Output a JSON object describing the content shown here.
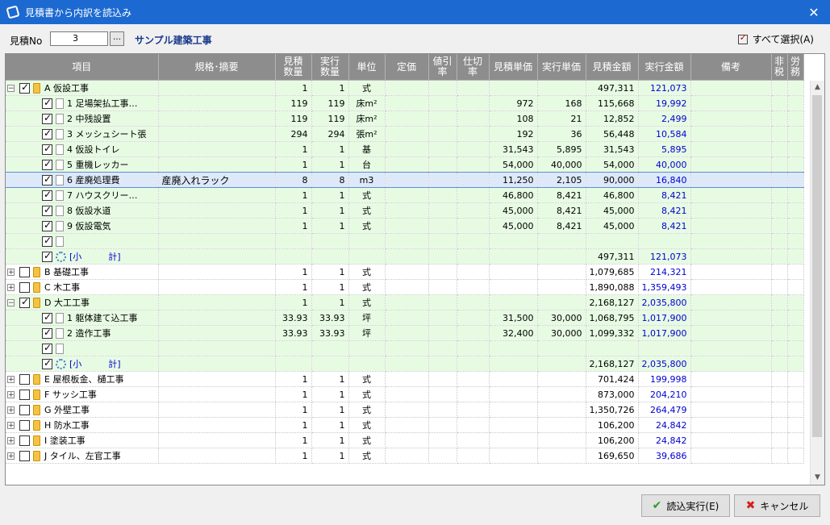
{
  "window": {
    "title": "見積書から内訳を読込み",
    "close": "✕"
  },
  "toolbar": {
    "no_label": "見積No",
    "no_value": "3",
    "browse_label": "…",
    "project_name": "サンプル建築工事",
    "select_all": "すべて選択(A)"
  },
  "columns": [
    "項目",
    "規格･摘要",
    "見積\n数量",
    "実行\n数量",
    "単位",
    "定価",
    "値引\n率",
    "仕切\n率",
    "見積単価",
    "実行単価",
    "見積金額",
    "実行金額",
    "備考",
    "非\n税",
    "労\n務"
  ],
  "rows": [
    {
      "style": "green",
      "expander": "−",
      "checked": true,
      "icon": "folder",
      "label": "A 仮設工事",
      "spec": "",
      "qty": "1",
      "exec_qty": "1",
      "unit": "式",
      "price": "",
      "disc": "",
      "part": "",
      "unit_price": "",
      "exec_unit_price": "",
      "amount": "497,311",
      "exec_amount": "121,073"
    },
    {
      "style": "green",
      "expander": "",
      "checked": true,
      "icon": "doc",
      "label": "1 足場架払工事…",
      "spec": "",
      "qty": "119",
      "exec_qty": "119",
      "unit": "床m²",
      "price": "",
      "disc": "",
      "part": "",
      "unit_price": "972",
      "exec_unit_price": "168",
      "amount": "115,668",
      "exec_amount": "19,992"
    },
    {
      "style": "green",
      "expander": "",
      "checked": true,
      "icon": "doc",
      "label": "2 中残設置",
      "spec": "",
      "qty": "119",
      "exec_qty": "119",
      "unit": "床m²",
      "price": "",
      "disc": "",
      "part": "",
      "unit_price": "108",
      "exec_unit_price": "21",
      "amount": "12,852",
      "exec_amount": "2,499"
    },
    {
      "style": "green",
      "expander": "",
      "checked": true,
      "icon": "doc",
      "label": "3 メッシュシート張",
      "spec": "",
      "qty": "294",
      "exec_qty": "294",
      "unit": "張m²",
      "price": "",
      "disc": "",
      "part": "",
      "unit_price": "192",
      "exec_unit_price": "36",
      "amount": "56,448",
      "exec_amount": "10,584"
    },
    {
      "style": "green",
      "expander": "",
      "checked": true,
      "icon": "doc",
      "label": "4 仮設トイレ",
      "spec": "",
      "qty": "1",
      "exec_qty": "1",
      "unit": "基",
      "price": "",
      "disc": "",
      "part": "",
      "unit_price": "31,543",
      "exec_unit_price": "5,895",
      "amount": "31,543",
      "exec_amount": "5,895"
    },
    {
      "style": "green",
      "expander": "",
      "checked": true,
      "icon": "doc",
      "label": "5 重機レッカー",
      "spec": "",
      "qty": "1",
      "exec_qty": "1",
      "unit": "台",
      "price": "",
      "disc": "",
      "part": "",
      "unit_price": "54,000",
      "exec_unit_price": "40,000",
      "amount": "54,000",
      "exec_amount": "40,000"
    },
    {
      "style": "sel",
      "expander": "",
      "checked": true,
      "icon": "doc",
      "label": "6 産廃処理費",
      "spec": "産廃入れラック",
      "qty": "8",
      "exec_qty": "8",
      "unit": "m3",
      "price": "",
      "disc": "",
      "part": "",
      "unit_price": "11,250",
      "exec_unit_price": "2,105",
      "amount": "90,000",
      "exec_amount": "16,840"
    },
    {
      "style": "green",
      "expander": "",
      "checked": true,
      "icon": "doc",
      "label": "7 ハウスクリー…",
      "spec": "",
      "qty": "1",
      "exec_qty": "1",
      "unit": "式",
      "price": "",
      "disc": "",
      "part": "",
      "unit_price": "46,800",
      "exec_unit_price": "8,421",
      "amount": "46,800",
      "exec_amount": "8,421"
    },
    {
      "style": "green",
      "expander": "",
      "checked": true,
      "icon": "doc",
      "label": "8 仮設水道",
      "spec": "",
      "qty": "1",
      "exec_qty": "1",
      "unit": "式",
      "price": "",
      "disc": "",
      "part": "",
      "unit_price": "45,000",
      "exec_unit_price": "8,421",
      "amount": "45,000",
      "exec_amount": "8,421"
    },
    {
      "style": "green",
      "expander": "",
      "checked": true,
      "icon": "doc",
      "label": "9 仮設電気",
      "spec": "",
      "qty": "1",
      "exec_qty": "1",
      "unit": "式",
      "price": "",
      "disc": "",
      "part": "",
      "unit_price": "45,000",
      "exec_unit_price": "8,421",
      "amount": "45,000",
      "exec_amount": "8,421"
    },
    {
      "style": "green",
      "expander": "",
      "checked": true,
      "icon": "doc",
      "label": "",
      "spec": "",
      "qty": "",
      "exec_qty": "",
      "unit": "",
      "price": "",
      "disc": "",
      "part": "",
      "unit_price": "",
      "exec_unit_price": "",
      "amount": "",
      "exec_amount": ""
    },
    {
      "style": "green",
      "expander": "",
      "checked": true,
      "icon": "gear",
      "label": "[小　　　計]",
      "spec": "",
      "qty": "",
      "exec_qty": "",
      "unit": "",
      "price": "",
      "disc": "",
      "part": "",
      "unit_price": "",
      "exec_unit_price": "",
      "amount": "497,311",
      "exec_amount": "121,073",
      "subtotal": true
    },
    {
      "style": "white",
      "expander": "+",
      "checked": false,
      "icon": "folder",
      "label": "B 基礎工事",
      "spec": "",
      "qty": "1",
      "exec_qty": "1",
      "unit": "式",
      "price": "",
      "disc": "",
      "part": "",
      "unit_price": "",
      "exec_unit_price": "",
      "amount": "1,079,685",
      "exec_amount": "214,321"
    },
    {
      "style": "white",
      "expander": "+",
      "checked": false,
      "icon": "folder",
      "label": "C 木工事",
      "spec": "",
      "qty": "1",
      "exec_qty": "1",
      "unit": "式",
      "price": "",
      "disc": "",
      "part": "",
      "unit_price": "",
      "exec_unit_price": "",
      "amount": "1,890,088",
      "exec_amount": "1,359,493"
    },
    {
      "style": "green",
      "expander": "−",
      "checked": true,
      "icon": "folder",
      "label": "D 大工工事",
      "spec": "",
      "qty": "1",
      "exec_qty": "1",
      "unit": "式",
      "price": "",
      "disc": "",
      "part": "",
      "unit_price": "",
      "exec_unit_price": "",
      "amount": "2,168,127",
      "exec_amount": "2,035,800"
    },
    {
      "style": "green",
      "expander": "",
      "checked": true,
      "icon": "doc",
      "label": "1 躯体建て込工事",
      "spec": "",
      "qty": "33.93",
      "exec_qty": "33.93",
      "unit": "坪",
      "price": "",
      "disc": "",
      "part": "",
      "unit_price": "31,500",
      "exec_unit_price": "30,000",
      "amount": "1,068,795",
      "exec_amount": "1,017,900"
    },
    {
      "style": "green",
      "expander": "",
      "checked": true,
      "icon": "doc",
      "label": "2 造作工事",
      "spec": "",
      "qty": "33.93",
      "exec_qty": "33.93",
      "unit": "坪",
      "price": "",
      "disc": "",
      "part": "",
      "unit_price": "32,400",
      "exec_unit_price": "30,000",
      "amount": "1,099,332",
      "exec_amount": "1,017,900"
    },
    {
      "style": "green",
      "expander": "",
      "checked": true,
      "icon": "doc",
      "label": "",
      "spec": "",
      "qty": "",
      "exec_qty": "",
      "unit": "",
      "price": "",
      "disc": "",
      "part": "",
      "unit_price": "",
      "exec_unit_price": "",
      "amount": "",
      "exec_amount": ""
    },
    {
      "style": "green",
      "expander": "",
      "checked": true,
      "icon": "gear",
      "label": "[小　　　計]",
      "spec": "",
      "qty": "",
      "exec_qty": "",
      "unit": "",
      "price": "",
      "disc": "",
      "part": "",
      "unit_price": "",
      "exec_unit_price": "",
      "amount": "2,168,127",
      "exec_amount": "2,035,800",
      "subtotal": true
    },
    {
      "style": "white",
      "expander": "+",
      "checked": false,
      "icon": "folder",
      "label": "E 屋根板金、樋工事",
      "spec": "",
      "qty": "1",
      "exec_qty": "1",
      "unit": "式",
      "price": "",
      "disc": "",
      "part": "",
      "unit_price": "",
      "exec_unit_price": "",
      "amount": "701,424",
      "exec_amount": "199,998"
    },
    {
      "style": "white",
      "expander": "+",
      "checked": false,
      "icon": "folder",
      "label": "F サッシ工事",
      "spec": "",
      "qty": "1",
      "exec_qty": "1",
      "unit": "式",
      "price": "",
      "disc": "",
      "part": "",
      "unit_price": "",
      "exec_unit_price": "",
      "amount": "873,000",
      "exec_amount": "204,210"
    },
    {
      "style": "white",
      "expander": "+",
      "checked": false,
      "icon": "folder",
      "label": "G 外壁工事",
      "spec": "",
      "qty": "1",
      "exec_qty": "1",
      "unit": "式",
      "price": "",
      "disc": "",
      "part": "",
      "unit_price": "",
      "exec_unit_price": "",
      "amount": "1,350,726",
      "exec_amount": "264,479"
    },
    {
      "style": "white",
      "expander": "+",
      "checked": false,
      "icon": "folder",
      "label": "H 防水工事",
      "spec": "",
      "qty": "1",
      "exec_qty": "1",
      "unit": "式",
      "price": "",
      "disc": "",
      "part": "",
      "unit_price": "",
      "exec_unit_price": "",
      "amount": "106,200",
      "exec_amount": "24,842"
    },
    {
      "style": "white",
      "expander": "+",
      "checked": false,
      "icon": "folder",
      "label": "I 塗装工事",
      "spec": "",
      "qty": "1",
      "exec_qty": "1",
      "unit": "式",
      "price": "",
      "disc": "",
      "part": "",
      "unit_price": "",
      "exec_unit_price": "",
      "amount": "106,200",
      "exec_amount": "24,842"
    },
    {
      "style": "white",
      "expander": "+",
      "checked": false,
      "icon": "folder",
      "label": "J タイル、左官工事",
      "spec": "",
      "qty": "1",
      "exec_qty": "1",
      "unit": "式",
      "price": "",
      "disc": "",
      "part": "",
      "unit_price": "",
      "exec_unit_price": "",
      "amount": "169,650",
      "exec_amount": "39,686"
    }
  ],
  "buttons": {
    "execute": "読込実行(E)",
    "cancel": "キャンセル"
  }
}
